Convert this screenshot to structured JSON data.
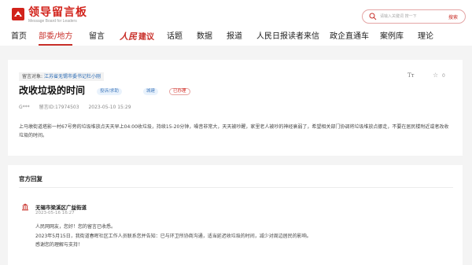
{
  "header": {
    "logo_title": "领导留言板",
    "logo_sub": "Message Board for Leaders",
    "search": {
      "placeholder": "请输入关键词 搜一下",
      "button_label": "搜索"
    }
  },
  "nav": {
    "items": [
      {
        "label": "首页"
      },
      {
        "label": "部委/地方"
      },
      {
        "label": "留言"
      },
      {
        "brand": "人民",
        "label": "建议"
      },
      {
        "label": "话题"
      },
      {
        "label": "数据"
      },
      {
        "label": "报道"
      },
      {
        "label": "人民日报读者来信"
      },
      {
        "label": "政企直通车"
      },
      {
        "label": "案例库"
      },
      {
        "label": "理论"
      }
    ],
    "active": "部委/地方"
  },
  "message": {
    "target_label": "留言对象:",
    "target_value": "江苏省无锡市委书记杜小刚",
    "font_icon_text": "Tт",
    "like_count": "0",
    "title": "改收垃圾的时间",
    "tags": [
      "投诉/求助",
      "城建",
      "已办理"
    ],
    "author": "G***",
    "message_id": "留言ID:17974503",
    "datetime": "2023-05-10 15:29",
    "body": "上马墩街道塔影一村67号旁的垃圾堆放点天天早上04:00收垃圾，持续15-20分钟，噪音非常大，天天被吵醒，家里老人被吵的神经衰弱了，希望相关部门协调将垃圾堆放点挪走，不要在居民楼附近或者改收垃圾的时间。"
  },
  "reply": {
    "section_title": "官方回复",
    "department": "无锡市梁溪区广益街道",
    "datetime": "2023-05-16 16:27",
    "lines": [
      "人民网网友，您好！您的留言已收悉。",
      "2023年5月15日，我街道春晖社区工作人员联系您并告知：已与环卫所协商沟通，适当延迟收垃圾的时间，减少对周边居民的影响。",
      "感谢您的理解与支持！"
    ]
  },
  "colors": {
    "brand_red": "#d2231b",
    "link_blue": "#2a6bb5",
    "tag_blue_bg": "#e9f2fc"
  }
}
